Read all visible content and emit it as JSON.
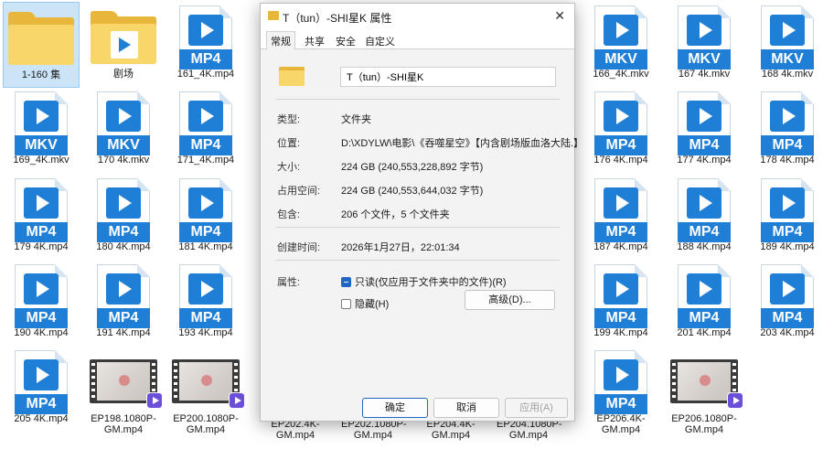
{
  "desktop": {
    "files": [
      {
        "label": "1-160 集",
        "type": "folder"
      },
      {
        "label": "剧场",
        "type": "media-folder"
      },
      {
        "label": "161_4K.mp4",
        "type": "MP4"
      },
      {
        "label": "166_4K.mkv",
        "type": "MKV"
      },
      {
        "label": "167 4k.mkv",
        "type": "MKV"
      },
      {
        "label": "168 4k.mkv",
        "type": "MKV"
      },
      {
        "label": "169_4K.mkv",
        "type": "MKV"
      },
      {
        "label": "170 4k.mkv",
        "type": "MKV"
      },
      {
        "label": "171_4K.mp4",
        "type": "MP4"
      },
      {
        "label": "176 4K.mp4",
        "type": "MP4"
      },
      {
        "label": "177 4K.mp4",
        "type": "MP4"
      },
      {
        "label": "178 4K.mp4",
        "type": "MP4"
      },
      {
        "label": "179 4K.mp4",
        "type": "MP4"
      },
      {
        "label": "180 4K.mp4",
        "type": "MP4"
      },
      {
        "label": "181 4K.mp4",
        "type": "MP4"
      },
      {
        "label": "187 4K.mp4",
        "type": "MP4"
      },
      {
        "label": "188 4K.mp4",
        "type": "MP4"
      },
      {
        "label": "189 4K.mp4",
        "type": "MP4"
      },
      {
        "label": "190 4K.mp4",
        "type": "MP4"
      },
      {
        "label": "191 4K.mp4",
        "type": "MP4"
      },
      {
        "label": "193 4K.mp4",
        "type": "MP4"
      },
      {
        "label": "199 4K.mp4",
        "type": "MP4"
      },
      {
        "label": "201 4K.mp4",
        "type": "MP4"
      },
      {
        "label": "203 4K.mp4",
        "type": "MP4"
      },
      {
        "label": "205 4K.mp4",
        "type": "MP4"
      },
      {
        "label": "EP198.1080P-GM.mp4",
        "type": "thumb"
      },
      {
        "label": "EP200.1080P-GM.mp4",
        "type": "thumb"
      },
      {
        "label": "EP206.4K-GM.mp4",
        "type": "MP4"
      },
      {
        "label": "EP206.1080P-GM.mp4",
        "type": "thumb"
      }
    ],
    "partial_labels": [
      "EP202.4K-GM.mp4",
      "EP202.1080P-GM.mp4",
      "EP204.4K-GM.mp4",
      "EP204.1080P-GM.mp4"
    ]
  },
  "dialog": {
    "title": "T（tun）-SHI星K 属性",
    "close_label": "✕",
    "tabs": [
      "常规",
      "共享",
      "安全",
      "自定义"
    ],
    "name_value": "T（tun）-SHI星K",
    "props": [
      {
        "key": "类型:",
        "value": "文件夹"
      },
      {
        "key": "位置:",
        "value": "D:\\XDYLW\\电影\\《吞噬星空》【内含剧场版血洛大陆.】"
      },
      {
        "key": "大小:",
        "value": "224 GB (240,553,228,892 字节)"
      },
      {
        "key": "占用空间:",
        "value": "224 GB (240,553,644,032 字节)"
      },
      {
        "key": "包含:",
        "value": "206 个文件，5 个文件夹"
      }
    ],
    "created": {
      "key": "创建时间:",
      "value": "2026年1月27日，22:01:34"
    },
    "attributes": {
      "key": "属性:",
      "readonly": {
        "label": "只读(仅应用于文件夹中的文件)(R)",
        "checked": true
      },
      "hidden": {
        "label": "隐藏(H)",
        "checked": false
      },
      "advanced_label": "高级(D)..."
    },
    "buttons": {
      "ok": "确定",
      "cancel": "取消",
      "apply": "应用(A)"
    }
  }
}
